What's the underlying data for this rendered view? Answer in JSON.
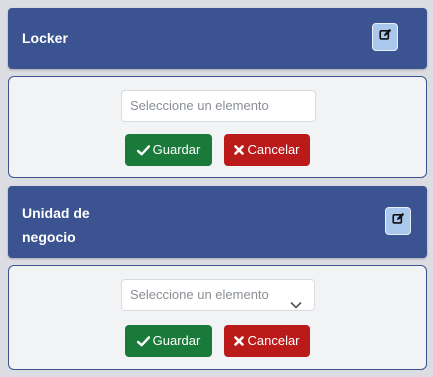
{
  "sections": [
    {
      "title": "Locker",
      "edit_icon": "edit-icon",
      "field": {
        "placeholder": "Seleccione un elemento",
        "type": "input"
      },
      "save_label": "Guardar",
      "cancel_label": "Cancelar"
    },
    {
      "title": "Unidad de negocio",
      "edit_icon": "edit-icon",
      "field": {
        "placeholder": "Seleccione un elemento",
        "type": "select"
      },
      "save_label": "Guardar",
      "cancel_label": "Cancelar"
    }
  ],
  "colors": {
    "header": "#3b5390",
    "edit_button": "#a9c8ec",
    "save": "#1a7a3a",
    "cancel": "#bb1a1a"
  }
}
